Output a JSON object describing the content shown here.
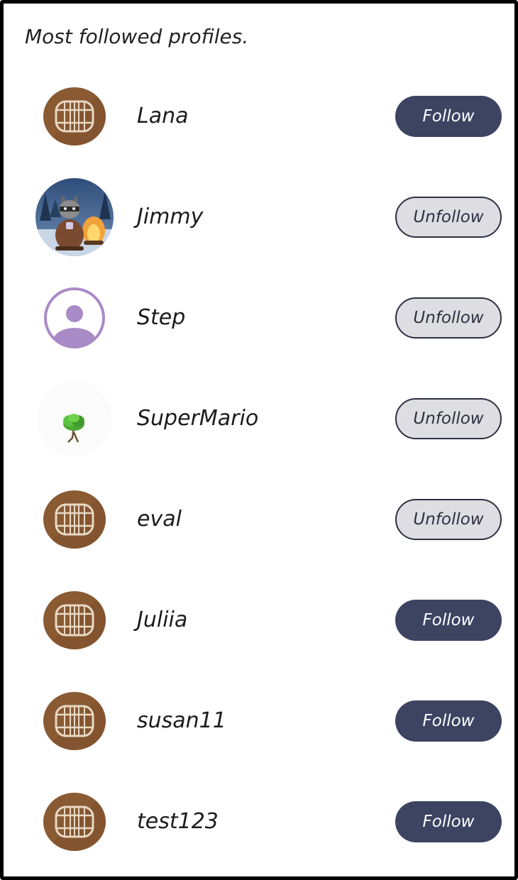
{
  "heading": "Most followed profiles.",
  "colors": {
    "follow_bg": "#3c4462",
    "unfollow_bg": "#dddde2",
    "unfollow_border": "#2d3140",
    "barrel_brown": "#8a5a33",
    "placeholder_purple": "#a98bc7"
  },
  "profiles": [
    {
      "name": "Lana",
      "avatar": "barrel-avatar",
      "button": "Follow"
    },
    {
      "name": "Jimmy",
      "avatar": "raccoon-campfire-avatar",
      "button": "Unfollow"
    },
    {
      "name": "Step",
      "avatar": "default-user-avatar",
      "button": "Unfollow"
    },
    {
      "name": "SuperMario",
      "avatar": "tree-avatar",
      "button": "Unfollow"
    },
    {
      "name": "eval",
      "avatar": "barrel-avatar",
      "button": "Unfollow"
    },
    {
      "name": "Juliia",
      "avatar": "barrel-avatar",
      "button": "Follow"
    },
    {
      "name": "susan11",
      "avatar": "barrel-avatar",
      "button": "Follow"
    },
    {
      "name": "test123",
      "avatar": "barrel-avatar",
      "button": "Follow"
    }
  ]
}
